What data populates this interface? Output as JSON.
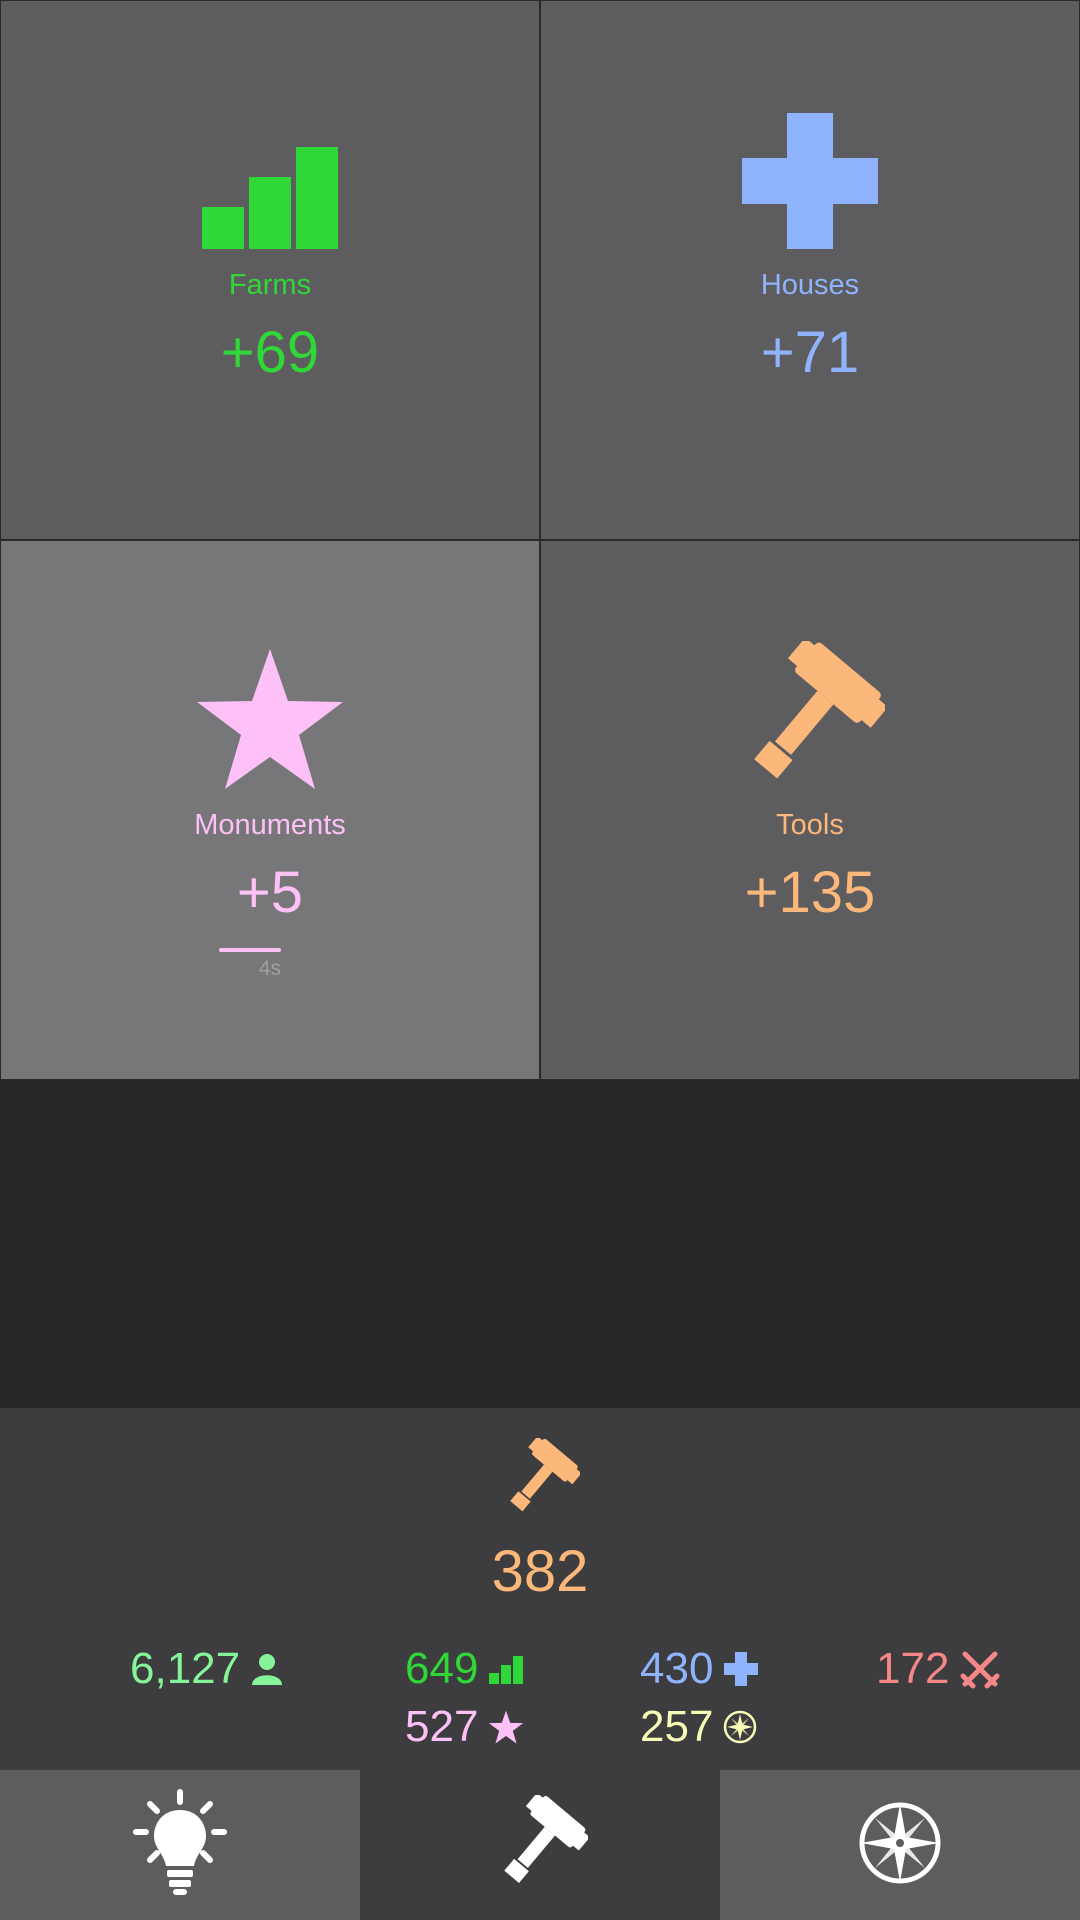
{
  "colors": {
    "farms": "#2fd836",
    "houses": "#8fb3fc",
    "monuments": "#fdc1f7",
    "tools": "#fcb77a",
    "population": "#86f59a",
    "soldiers": "#f58886",
    "exploration": "#f7fbb6",
    "white": "#ffffff"
  },
  "tiles": [
    {
      "label": "Farms",
      "value": "+69",
      "icon": "bar-chart-icon"
    },
    {
      "label": "Houses",
      "value": "+71",
      "icon": "plus-icon"
    },
    {
      "label": "Monuments",
      "value": "+5",
      "icon": "star-icon",
      "timer": "4s",
      "progress": 0.62
    },
    {
      "label": "Tools",
      "value": "+135",
      "icon": "hammer-icon"
    }
  ],
  "summary": {
    "selected_icon": "hammer-icon",
    "selected_value": "382",
    "stats": {
      "population": "6,127",
      "farms": "649",
      "houses": "430",
      "soldiers": "172",
      "monuments": "527",
      "exploration": "257"
    }
  },
  "nav": [
    {
      "icon": "lightbulb-icon"
    },
    {
      "icon": "hammer-icon",
      "active": true
    },
    {
      "icon": "compass-icon"
    }
  ]
}
